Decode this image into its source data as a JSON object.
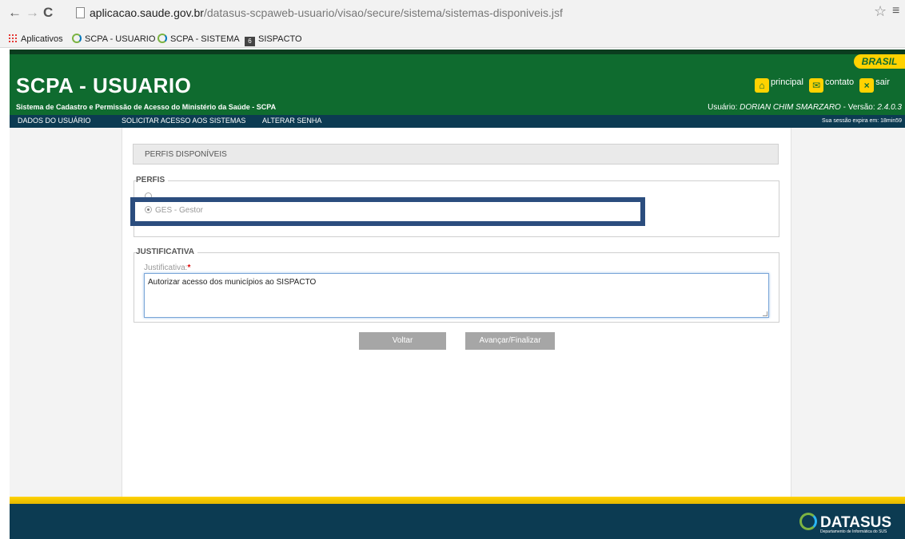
{
  "browser": {
    "url_host": "aplicacao.saude.gov.br",
    "url_path": "/datasus-scpaweb-usuario/visao/secure/sistema/sistemas-disponiveis.jsf",
    "bookmarks": [
      "Aplicativos",
      "SCPA - USUARIO",
      "SCPA - SISTEMA",
      "SISPACTO"
    ]
  },
  "header": {
    "brand_badge": "BRASIL",
    "title": "SCPA - USUARIO",
    "subtitle": "Sistema de Cadastro e Permissão de Acesso do Ministério da Saúde - SCPA",
    "links": [
      "principal",
      "contato",
      "sair"
    ],
    "user_prefix": "Usuário: ",
    "user_name": "DORIAN CHIM SMARZARO",
    "version_prefix": " - Versão: ",
    "version": "2.4.0.3"
  },
  "menu": {
    "items": [
      "DADOS DO USUÁRIO",
      "SOLICITAR ACESSO AOS SISTEMAS",
      "ALTERAR SENHA"
    ],
    "session_text": "Sua sessão expira em: 18min59"
  },
  "main": {
    "panel_title": "PERFIS DISPONÍVEIS",
    "perfis_legend": "PERFIS",
    "selected_profile": "GES - Gestor",
    "justificativa_legend": "JUSTIFICATIVA",
    "justificativa_label": "Justificativa:",
    "required_mark": "*",
    "justificativa_value": "Autorizar acesso dos municípios ao SISPACTO",
    "buttons": [
      "Voltar",
      "Avançar/Finalizar"
    ]
  },
  "footer": {
    "logo_text": "DATASUS",
    "logo_sub": "Departamento de Informática do SUS"
  },
  "colors": {
    "header_green": "#0f6b2f",
    "menu_navy": "#0c3b52",
    "brand_yellow": "#ffd200",
    "highlight_border": "#2b4d7e",
    "button_gray": "#a6a6a6"
  }
}
